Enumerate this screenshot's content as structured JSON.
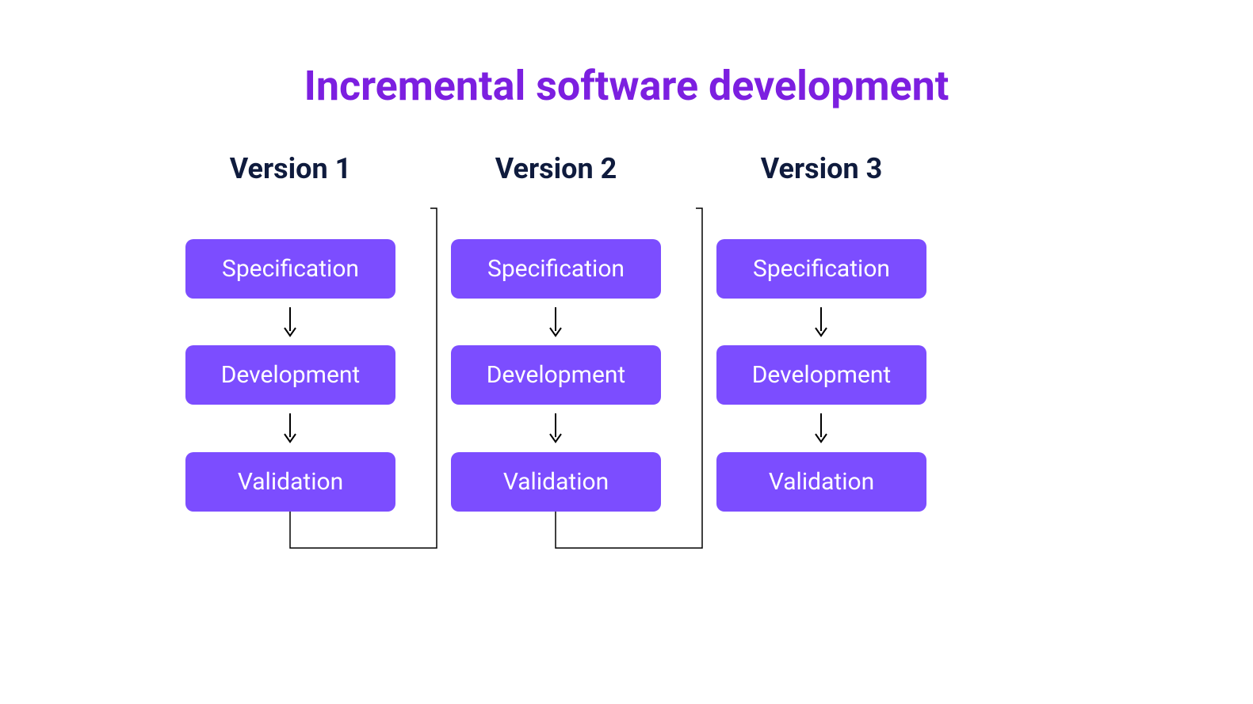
{
  "title": "Incremental software development",
  "colors": {
    "title": "#7c1fe0",
    "box": "#7c4dff",
    "boxText": "#ffffff",
    "versionText": "#0f1b3d",
    "arrow": "#000000",
    "connector": "#000000"
  },
  "columns": [
    {
      "label": "Version 1",
      "steps": [
        "Specification",
        "Development",
        "Validation"
      ]
    },
    {
      "label": "Version 2",
      "steps": [
        "Specification",
        "Development",
        "Validation"
      ]
    },
    {
      "label": "Version 3",
      "steps": [
        "Specification",
        "Development",
        "Validation"
      ]
    }
  ]
}
